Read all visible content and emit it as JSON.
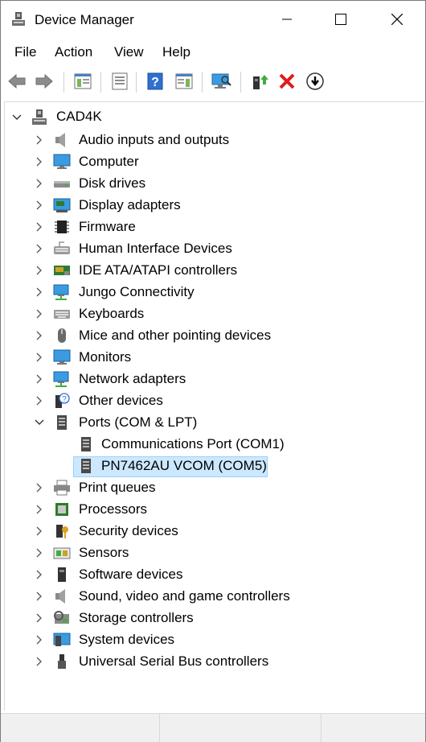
{
  "window": {
    "title": "Device Manager"
  },
  "menu": {
    "file": "File",
    "action": "Action",
    "view": "View",
    "help": "Help"
  },
  "toolbar": {
    "icons": [
      "back-arrow-icon",
      "forward-arrow-icon",
      "properties-pane-icon",
      "properties-icon",
      "help-icon",
      "action-pane-icon",
      "scan-hardware-icon",
      "update-driver-icon",
      "uninstall-icon",
      "disable-device-icon"
    ]
  },
  "tree": {
    "root": "CAD4K",
    "categories": [
      "Audio inputs and outputs",
      "Computer",
      "Disk drives",
      "Display adapters",
      "Firmware",
      "Human Interface Devices",
      "IDE ATA/ATAPI controllers",
      "Jungo Connectivity",
      "Keyboards",
      "Mice and other pointing devices",
      "Monitors",
      "Network adapters",
      "Other devices",
      "Ports (COM & LPT)",
      "Print queues",
      "Processors",
      "Security devices",
      "Sensors",
      "Software devices",
      "Sound, video and game controllers",
      "Storage controllers",
      "System devices",
      "Universal Serial Bus controllers"
    ],
    "ports_children": [
      "Communications Port (COM1)",
      "PN7462AU VCOM (COM5)"
    ]
  },
  "colors": {
    "selection": "#cce8ff",
    "selection_border": "#99d1ff",
    "accent": "#1f6fd6"
  }
}
